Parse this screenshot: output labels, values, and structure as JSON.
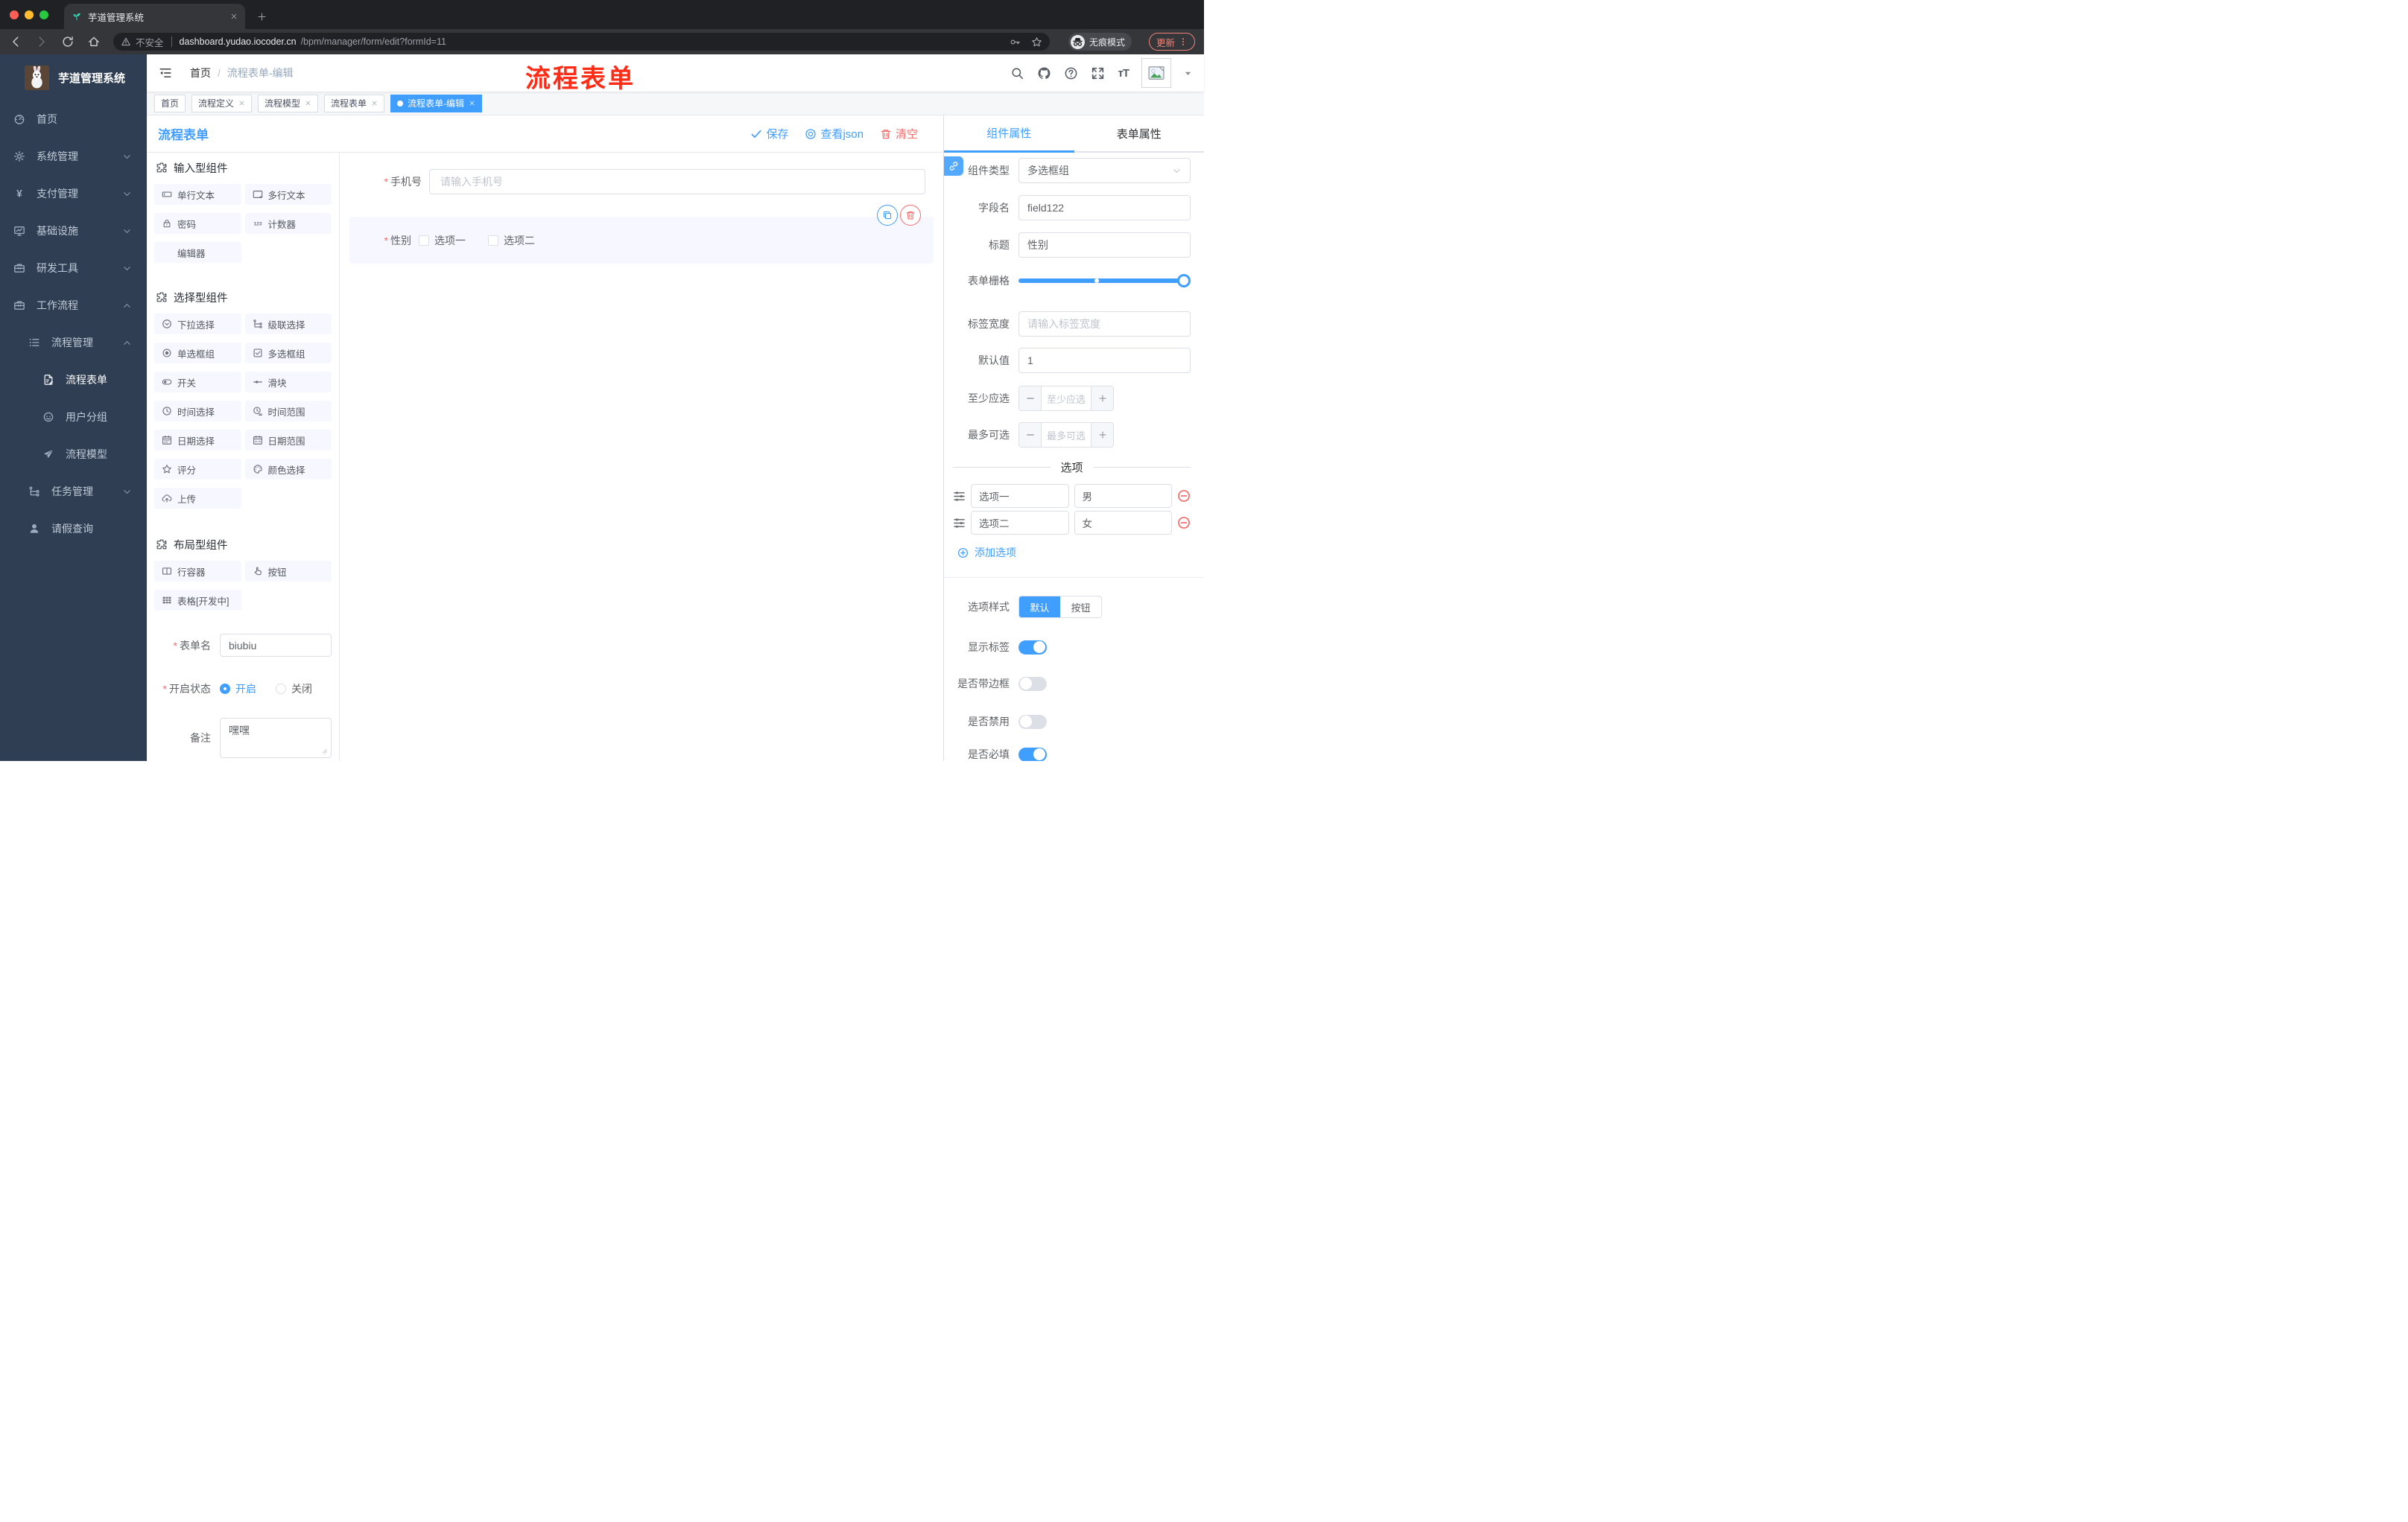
{
  "colors": {
    "accent": "#409eff",
    "danger": "#f56c6c",
    "annotation_red": "#fd2c17",
    "sidebar_bg": "#2f3e52",
    "chrome_dark": "#202124"
  },
  "browser": {
    "tab_title": "芋道管理系统",
    "security_label": "不安全",
    "url_domain": "dashboard.yudao.iocoder.cn",
    "url_path": "/bpm/manager/form/edit?formId=11",
    "incognito_label": "无痕模式",
    "update_label": "更新"
  },
  "sidebar": {
    "logo_title": "芋道管理系统",
    "menu": [
      {
        "label": "首页",
        "icon": "dashboard-icon",
        "level": 1
      },
      {
        "label": "系统管理",
        "icon": "gear-icon",
        "level": 1,
        "chevron": "down"
      },
      {
        "label": "支付管理",
        "icon": "yen-icon",
        "level": 1,
        "chevron": "down"
      },
      {
        "label": "基础设施",
        "icon": "monitor-icon",
        "level": 1,
        "chevron": "down"
      },
      {
        "label": "研发工具",
        "icon": "toolbox-icon",
        "level": 1,
        "chevron": "down"
      },
      {
        "label": "工作流程",
        "icon": "toolbox-icon",
        "level": 1,
        "chevron": "up"
      },
      {
        "label": "流程管理",
        "icon": "list-icon",
        "level": 2,
        "chevron": "up"
      },
      {
        "label": "流程表单",
        "icon": "doc-edit-icon",
        "level": 3,
        "active": true
      },
      {
        "label": "用户分组",
        "icon": "face-icon",
        "level": 3
      },
      {
        "label": "流程模型",
        "icon": "send-icon",
        "level": 3
      },
      {
        "label": "任务管理",
        "icon": "tree-icon",
        "level": 2,
        "chevron": "down"
      },
      {
        "label": "请假查询",
        "icon": "user-icon",
        "level": 2
      }
    ]
  },
  "navbar": {
    "breadcrumb_home": "首页",
    "separator": "/",
    "breadcrumb_current": "流程表单-编辑",
    "annotation": "流程表单"
  },
  "tags": [
    {
      "label": "首页",
      "closable": false,
      "active": false
    },
    {
      "label": "流程定义",
      "closable": true,
      "active": false
    },
    {
      "label": "流程模型",
      "closable": true,
      "active": false
    },
    {
      "label": "流程表单",
      "closable": true,
      "active": false
    },
    {
      "label": "流程表单-编辑",
      "closable": true,
      "active": true
    }
  ],
  "editor": {
    "title": "流程表单",
    "save_label": "保存",
    "view_json_label": "查看json",
    "clear_label": "清空"
  },
  "components_panel": {
    "sections": [
      {
        "title": "输入型组件",
        "items": [
          {
            "label": "单行文本",
            "icon": "input-icon"
          },
          {
            "label": "多行文本",
            "icon": "textarea-icon"
          },
          {
            "label": "密码",
            "icon": "lock-icon"
          },
          {
            "label": "计数器",
            "icon": "counter-icon"
          },
          {
            "label": "编辑器",
            "icon": ""
          }
        ]
      },
      {
        "title": "选择型组件",
        "items": [
          {
            "label": "下拉选择",
            "icon": "select-icon"
          },
          {
            "label": "级联选择",
            "icon": "cascade-icon"
          },
          {
            "label": "单选框组",
            "icon": "radio-icon"
          },
          {
            "label": "多选框组",
            "icon": "checkbox-icon"
          },
          {
            "label": "开关",
            "icon": "switch-icon"
          },
          {
            "label": "滑块",
            "icon": "slider-icon"
          },
          {
            "label": "时间选择",
            "icon": "time-icon"
          },
          {
            "label": "时间范围",
            "icon": "time-range-icon"
          },
          {
            "label": "日期选择",
            "icon": "date-icon"
          },
          {
            "label": "日期范围",
            "icon": "date-range-icon"
          },
          {
            "label": "评分",
            "icon": "star-icon"
          },
          {
            "label": "颜色选择",
            "icon": "palette-icon"
          },
          {
            "label": "上传",
            "icon": "upload-icon"
          }
        ]
      },
      {
        "title": "布局型组件",
        "items": [
          {
            "label": "行容器",
            "icon": "columns-icon"
          },
          {
            "label": "按钮",
            "icon": "hand-icon"
          },
          {
            "label": "表格[开发中]",
            "icon": "table-icon"
          }
        ]
      }
    ],
    "meta_form": {
      "name_label": "表单名",
      "name_value": "biubiu",
      "status_label": "开启状态",
      "status_on": "开启",
      "status_off": "关闭",
      "remark_label": "备注",
      "remark_value": "嘿嘿"
    }
  },
  "canvas": {
    "phone_field": {
      "label": "手机号",
      "placeholder": "请输入手机号"
    },
    "gender_field": {
      "label": "性别",
      "option1": "选项一",
      "option2": "选项二"
    }
  },
  "properties": {
    "tab_component": "组件属性",
    "tab_form": "表单属性",
    "component_type_label": "组件类型",
    "component_type_value": "多选框组",
    "field_name_label": "字段名",
    "field_name_value": "field122",
    "title_label": "标题",
    "title_value": "性别",
    "grid_label": "表单栅格",
    "label_width_label": "标签宽度",
    "label_width_placeholder": "请输入标签宽度",
    "default_label": "默认值",
    "default_value": "1",
    "min_label": "至少应选",
    "min_placeholder": "至少应选",
    "max_label": "最多可选",
    "max_placeholder": "最多可选",
    "options_title": "选项",
    "options": [
      {
        "label": "选项一",
        "value": "男"
      },
      {
        "label": "选项二",
        "value": "女"
      }
    ],
    "add_option_label": "添加选项",
    "style_label": "选项样式",
    "style_options": [
      "默认",
      "按钮"
    ],
    "style_active": 0,
    "toggles": [
      {
        "label": "显示标签",
        "on": true
      },
      {
        "label": "是否带边框",
        "on": false
      },
      {
        "label": "是否禁用",
        "on": false
      },
      {
        "label": "是否必填",
        "on": true
      }
    ]
  }
}
